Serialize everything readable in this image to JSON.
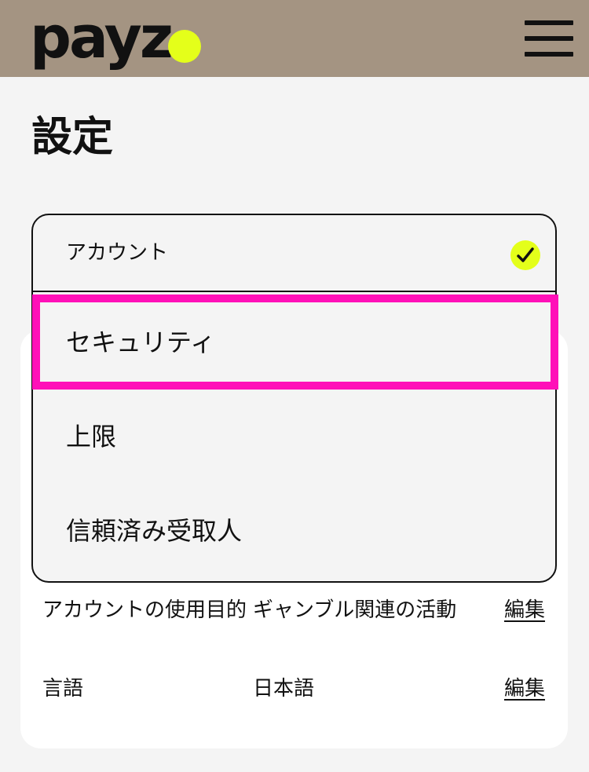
{
  "header": {
    "logo_text": "payz",
    "menu_icon": "hamburger-menu-icon",
    "background": "#a49482",
    "accent": "#e4ff1a"
  },
  "page": {
    "title": "設定"
  },
  "dropdown": {
    "selected": "アカウント",
    "options": [
      "セキュリティ",
      "上限",
      "信頼済み受取人"
    ],
    "highlight_color": "#ff10b8"
  },
  "settings": [
    {
      "label": "アカウントの使用目的",
      "value": "ギャンブル関連の活動",
      "edit": "編集"
    },
    {
      "label": "言語",
      "value": "日本語",
      "edit": "編集"
    }
  ]
}
